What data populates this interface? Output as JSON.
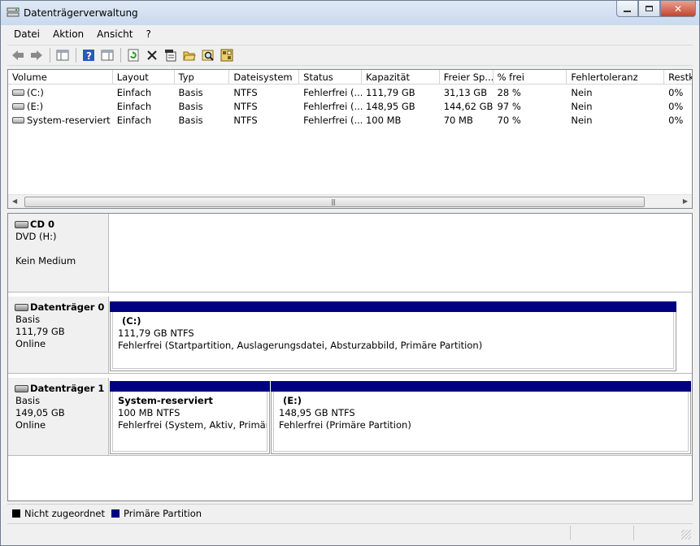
{
  "window": {
    "title": "Datenträgerverwaltung"
  },
  "menu": [
    "Datei",
    "Aktion",
    "Ansicht",
    "?"
  ],
  "toolbar": {
    "buttons": [
      "back-icon",
      "forward-icon",
      "console-tree-icon",
      "help-icon",
      "properties-pane-icon",
      "refresh-icon",
      "delete-icon",
      "properties-icon",
      "open-icon",
      "explore-icon",
      "rescan-icon"
    ]
  },
  "volume_list": {
    "columns": [
      "Volume",
      "Layout",
      "Typ",
      "Dateisystem",
      "Status",
      "Kapazität",
      "Freier Sp...",
      "% frei",
      "Fehlertoleranz",
      "Restk"
    ],
    "rows": [
      [
        "(C:)",
        "Einfach",
        "Basis",
        "NTFS",
        "Fehlerfrei (...",
        "111,79 GB",
        "31,13 GB",
        "28 %",
        "Nein",
        "0%"
      ],
      [
        "(E:)",
        "Einfach",
        "Basis",
        "NTFS",
        "Fehlerfrei (...",
        "148,95 GB",
        "144,62 GB",
        "97 %",
        "Nein",
        "0%"
      ],
      [
        "System-reserviert",
        "Einfach",
        "Basis",
        "NTFS",
        "Fehlerfrei (...",
        "100 MB",
        "70 MB",
        "70 %",
        "Nein",
        "0%"
      ]
    ]
  },
  "disks": [
    {
      "name": "CD 0",
      "line1": "DVD (H:)",
      "line2": "",
      "line3": "Kein Medium",
      "partitions": []
    },
    {
      "name": "Datenträger 0",
      "line1": "Basis",
      "line2": "111,79 GB",
      "line3": "Online",
      "partitions": [
        {
          "name": "(C:)",
          "size": "111,79 GB NTFS",
          "status": "Fehlerfrei (Startpartition, Auslagerungsdatei, Absturzabbild, Primäre Partition)"
        }
      ]
    },
    {
      "name": "Datenträger 1",
      "line1": "Basis",
      "line2": "149,05 GB",
      "line3": "Online",
      "partitions": [
        {
          "name": "System-reserviert",
          "size": "100 MB NTFS",
          "status": "Fehlerfrei (System, Aktiv, Primäre P"
        },
        {
          "name": "(E:)",
          "size": "148,95 GB NTFS",
          "status": "Fehlerfrei (Primäre Partition)"
        }
      ]
    }
  ],
  "legend": [
    {
      "label": "Nicht zugeordnet",
      "color": "#000000"
    },
    {
      "label": "Primäre Partition",
      "color": "#000080"
    }
  ],
  "colors": {
    "primary_partition": "#000080",
    "unallocated": "#000000"
  }
}
